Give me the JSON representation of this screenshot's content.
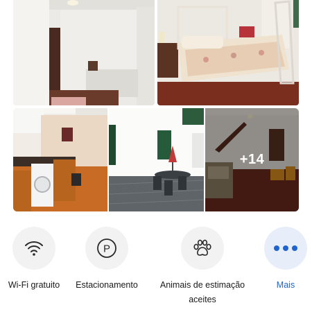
{
  "gallery": {
    "more_photos_label": "+14"
  },
  "facilities": {
    "wifi": {
      "label": "Wi-Fi gratuito",
      "icon": "wifi-icon"
    },
    "parking": {
      "label": "Estacionamento",
      "icon": "parking-icon"
    },
    "pets": {
      "label": "Animais de estimação aceites",
      "icon": "paw-icon"
    },
    "more": {
      "label": "Mais",
      "icon": "more-dots-icon"
    }
  },
  "colors": {
    "accent": "#1f63d1",
    "icon_circle": "#f2f2f2",
    "more_circle": "#e8eef9"
  }
}
